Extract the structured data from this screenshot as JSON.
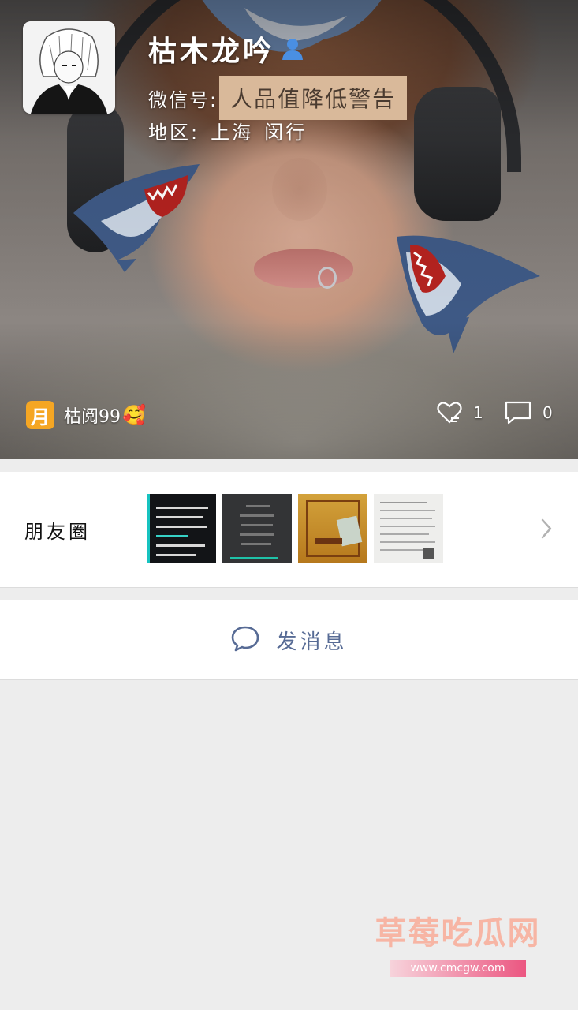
{
  "profile": {
    "nickname": "枯木龙吟",
    "wechat_id_label": "微信号:",
    "wechat_id_value": "人品值降低警告",
    "region_label": "地区:",
    "region_city": "上海",
    "region_district": "闵行",
    "gender_icon": "male-user-icon",
    "gender_color": "#4a8fe2"
  },
  "status": {
    "badge": "月",
    "text": "枯阅99",
    "emoji": "🥰",
    "badge_color": "#f5a623"
  },
  "cover_stats": {
    "likes": "1",
    "comments": "0"
  },
  "moments": {
    "label": "朋友圈"
  },
  "actions": {
    "send_message": "发消息",
    "accent_color": "#576b95"
  },
  "watermark": {
    "title": "草莓吃瓜网",
    "url": "www.cmcgw.com"
  }
}
